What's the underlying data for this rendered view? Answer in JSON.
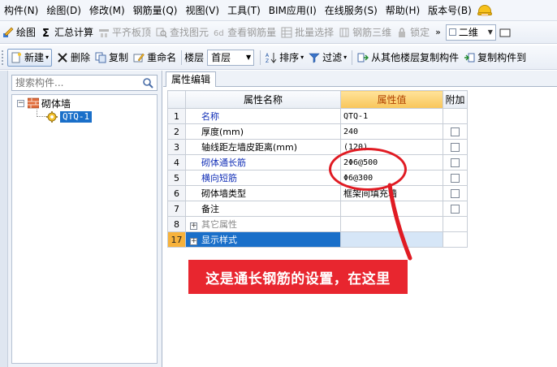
{
  "menu": [
    "构件(N)",
    "绘图(D)",
    "修改(M)",
    "钢筋量(Q)",
    "视图(V)",
    "工具(T)",
    "BIM应用(I)",
    "在线服务(S)",
    "帮助(H)",
    "版本号(B)"
  ],
  "toolbar1": {
    "draw": "绘图",
    "sum": "汇总计算",
    "align_slab": "平齐板顶",
    "find_element": "查找图元",
    "view_rebar": "查看钢筋量",
    "batch_select": "批量选择",
    "rebar_3d": "钢筋三维",
    "lock": "锁定",
    "view_mode": "二维"
  },
  "toolbar2": {
    "new": "新建",
    "delete": "删除",
    "copy": "复制",
    "rename": "重命名",
    "floor_label": "楼层",
    "floor_value": "首层",
    "sort": "排序",
    "filter": "过滤",
    "copy_from_floor": "从其他楼层复制构件",
    "copy_to": "复制构件到"
  },
  "left": {
    "search_placeholder": "搜索构件...",
    "tree_root": "砌体墙",
    "tree_child": "QTQ-1"
  },
  "right": {
    "tab": "属性编辑",
    "headers": {
      "name": "属性名称",
      "value": "属性值",
      "extra": "附加"
    },
    "rows": [
      {
        "num": "1",
        "name": "名称",
        "value": "QTQ-1"
      },
      {
        "num": "2",
        "name": "厚度(mm)",
        "value": "240"
      },
      {
        "num": "3",
        "name": "轴线距左墙皮距离(mm)",
        "value": "(120)"
      },
      {
        "num": "4",
        "name": "砌体通长筋",
        "value": "2Φ6@500"
      },
      {
        "num": "5",
        "name": "横向短筋",
        "value": "Φ6@300"
      },
      {
        "num": "6",
        "name": "砌体墙类型",
        "value": "框架间填充墙"
      },
      {
        "num": "7",
        "name": "备注",
        "value": ""
      },
      {
        "num": "8",
        "name": "其它属性",
        "value": ""
      },
      {
        "num": "17",
        "name": "显示样式",
        "value": ""
      }
    ]
  },
  "annotation": "这是通长钢筋的设置，在这里",
  "colors": {
    "annotation_red": "#e8262f",
    "selection_blue": "#1a6fc9",
    "header_orange": "#f8c55a"
  }
}
